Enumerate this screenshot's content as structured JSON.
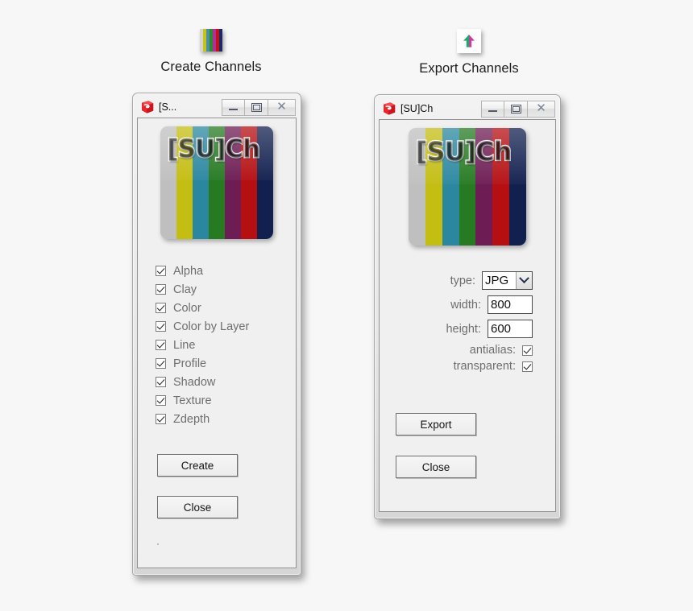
{
  "page": {
    "background_color": "#f7f7f7"
  },
  "panels": {
    "create": {
      "caption": "Create Channels",
      "icon": "color-bars-icon",
      "window": {
        "title": "[S...",
        "app_icon": "sketchup-logo-icon",
        "buttons": {
          "minimize": "minimize-icon",
          "maximize": "maximize-icon",
          "close": "close-icon"
        },
        "banner_text": "[SU]Ch",
        "checkboxes": [
          {
            "label": "Alpha",
            "checked": true
          },
          {
            "label": "Clay",
            "checked": true
          },
          {
            "label": "Color",
            "checked": true
          },
          {
            "label": "Color by Layer",
            "checked": true
          },
          {
            "label": "Line",
            "checked": true
          },
          {
            "label": "Profile",
            "checked": true
          },
          {
            "label": "Shadow",
            "checked": true
          },
          {
            "label": "Texture",
            "checked": true
          },
          {
            "label": "Zdepth",
            "checked": true
          }
        ],
        "create_button": "Create",
        "close_button": "Close"
      }
    },
    "export": {
      "caption": "Export Channels",
      "icon": "export-arrow-icon",
      "window": {
        "title": "[SU]Ch",
        "app_icon": "sketchup-logo-icon",
        "buttons": {
          "minimize": "minimize-icon",
          "maximize": "maximize-icon",
          "close": "close-icon"
        },
        "banner_text": "[SU]Ch",
        "form": {
          "type_label": "type:",
          "type_value": "JPG",
          "width_label": "width:",
          "width_value": "800",
          "height_label": "height:",
          "height_value": "600",
          "antialias_label": "antialias:",
          "antialias_checked": true,
          "transparent_label": "transparent:",
          "transparent_checked": true
        },
        "export_button": "Export",
        "close_button": "Close"
      }
    }
  },
  "colors": {
    "banner_stripes": [
      "#bfbfbf",
      "#c4bd12",
      "#2b87a0",
      "#267a22",
      "#6d1c54",
      "#b50f12",
      "#12204f"
    ],
    "icon_stripes": [
      "#d4d4d4",
      "#c9c314",
      "#4a8fa8",
      "#2d8b2a",
      "#b02fa0",
      "#c41016",
      "#1a2a66"
    ],
    "sketchup_red": "#e8262c",
    "export_arrow_left": "#1fa86a",
    "export_arrow_right": "#c43fa0"
  }
}
